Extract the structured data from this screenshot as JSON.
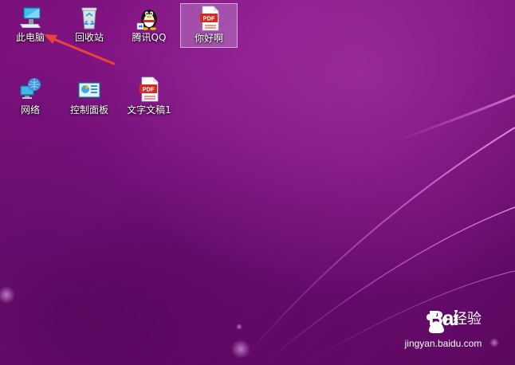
{
  "desktop": {
    "background_color": "#7a1079",
    "icons": [
      {
        "label": "此电脑",
        "icon": "computer-icon",
        "selected": false
      },
      {
        "label": "回收站",
        "icon": "recycle-bin-icon",
        "selected": false
      },
      {
        "label": "腾讯QQ",
        "icon": "qq-penguin-icon",
        "selected": false
      },
      {
        "label": "你好啊",
        "icon": "pdf-file-icon",
        "selected": true
      },
      {
        "label": "网络",
        "icon": "network-icon",
        "selected": false
      },
      {
        "label": "控制面板",
        "icon": "control-panel-icon",
        "selected": false
      },
      {
        "label": "文字文稿1",
        "icon": "pdf-file-icon",
        "selected": false
      }
    ],
    "pdf_badge_text": "PDF",
    "annotation": {
      "color": "#e8443a",
      "points_to": "此电脑"
    }
  },
  "watermark": {
    "brand": "Bai  经验",
    "brand_left": "Bai",
    "brand_right": "经验",
    "url": "jingyan.baidu.com"
  }
}
